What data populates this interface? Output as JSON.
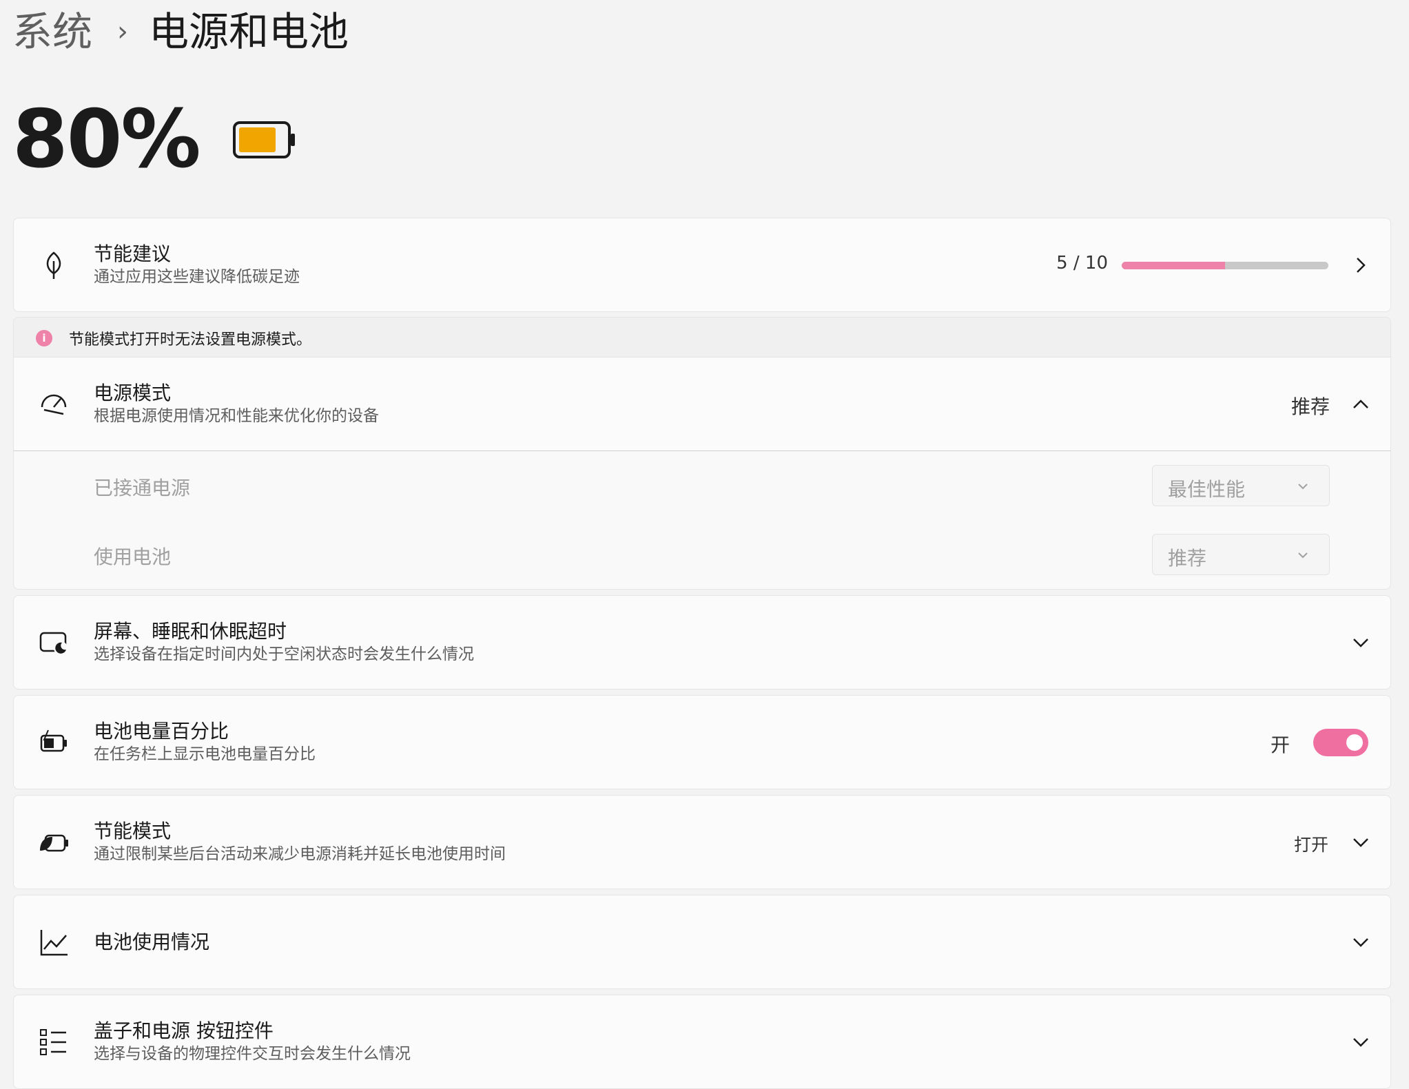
{
  "breadcrumb": {
    "parent": "系统",
    "separator": "›",
    "current": "电源和电池"
  },
  "battery": {
    "percent_label": "80%",
    "level": 0.8,
    "fill_color": "#f0a500"
  },
  "energy_recommendations": {
    "title": "节能建议",
    "subtitle": "通过应用这些建议降低碳足迹",
    "progress_label": "5 / 10",
    "progress_fraction": 0.5,
    "accent_color": "#ee82a8"
  },
  "notice": {
    "text": "节能模式打开时无法设置电源模式。",
    "icon": "info-icon"
  },
  "power_mode": {
    "title": "电源模式",
    "subtitle": "根据电源使用情况和性能来优化你的设备",
    "current_value": "推荐",
    "plugged_in_label": "已接通电源",
    "plugged_in_value": "最佳性能",
    "on_battery_label": "使用电池",
    "on_battery_value": "推荐"
  },
  "screen_sleep": {
    "title": "屏幕、睡眠和休眠超时",
    "subtitle": "选择设备在指定时间内处于空闲状态时会发生什么情况"
  },
  "battery_percentage": {
    "title": "电池电量百分比",
    "subtitle": "在任务栏上显示电池电量百分比",
    "toggle_label": "开",
    "toggle_on": true
  },
  "energy_saver": {
    "title": "节能模式",
    "subtitle": "通过限制某些后台活动来减少电源消耗并延长电池使用时间",
    "status": "打开"
  },
  "battery_usage": {
    "title": "电池使用情况"
  },
  "lid_power_buttons": {
    "title": "盖子和电源 按钮控件",
    "subtitle": "选择与设备的物理控件交互时会发生什么情况"
  }
}
